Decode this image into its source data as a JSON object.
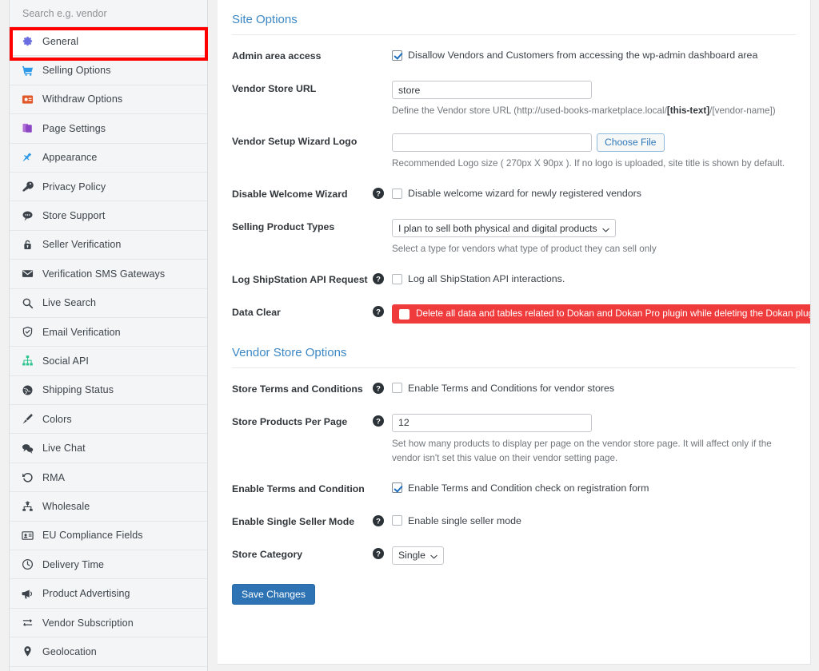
{
  "sidebar": {
    "search": {
      "placeholder": "Search e.g. vendor",
      "value": ""
    },
    "items": [
      {
        "label": "General",
        "icon": "gear-icon",
        "active": true
      },
      {
        "label": "Selling Options",
        "icon": "cart-icon",
        "active": false
      },
      {
        "label": "Withdraw Options",
        "icon": "withdraw-icon",
        "active": false
      },
      {
        "label": "Page Settings",
        "icon": "pages-icon",
        "active": false
      },
      {
        "label": "Appearance",
        "icon": "pushpin-icon",
        "active": false
      },
      {
        "label": "Privacy Policy",
        "icon": "key-icon",
        "active": false
      },
      {
        "label": "Store Support",
        "icon": "chat-bubble-icon",
        "active": false
      },
      {
        "label": "Seller Verification",
        "icon": "lock-icon",
        "active": false
      },
      {
        "label": "Verification SMS Gateways",
        "icon": "envelope-icon",
        "active": false
      },
      {
        "label": "Live Search",
        "icon": "search-icon",
        "active": false
      },
      {
        "label": "Email Verification",
        "icon": "shield-icon",
        "active": false
      },
      {
        "label": "Social API",
        "icon": "sitemap-icon",
        "active": false
      },
      {
        "label": "Shipping Status",
        "icon": "globe-icon",
        "active": false
      },
      {
        "label": "Colors",
        "icon": "brush-icon",
        "active": false
      },
      {
        "label": "Live Chat",
        "icon": "comments-icon",
        "active": false
      },
      {
        "label": "RMA",
        "icon": "undo-icon",
        "active": false
      },
      {
        "label": "Wholesale",
        "icon": "hierarchy-icon",
        "active": false
      },
      {
        "label": "EU Compliance Fields",
        "icon": "id-card-icon",
        "active": false
      },
      {
        "label": "Delivery Time",
        "icon": "clock-icon",
        "active": false
      },
      {
        "label": "Product Advertising",
        "icon": "megaphone-icon",
        "active": false
      },
      {
        "label": "Vendor Subscription",
        "icon": "refresh-box-icon",
        "active": false
      },
      {
        "label": "Geolocation",
        "icon": "map-pin-icon",
        "active": false
      }
    ]
  },
  "colors": {
    "section_heading": "#3c87c4",
    "danger": "#ef3b3b",
    "primary_button": "#2e74b5",
    "highlight_outline": "#ff0000"
  },
  "site_options": {
    "heading": "Site Options",
    "admin_area_access": {
      "label": "Admin area access",
      "checkbox_label": "Disallow Vendors and Customers from accessing the wp-admin dashboard area",
      "checked": true
    },
    "vendor_store_url": {
      "label": "Vendor Store URL",
      "value": "store",
      "hint_before": "Define the Vendor store URL (http://used-books-marketplace.local/",
      "hint_bold": "[this-text]",
      "hint_after": "/[vendor-name])"
    },
    "vendor_setup_wizard_logo": {
      "label": "Vendor Setup Wizard Logo",
      "value": "",
      "button": "Choose File",
      "hint": "Recommended Logo size ( 270px X 90px ). If no logo is uploaded, site title is shown by default."
    },
    "disable_welcome_wizard": {
      "label": "Disable Welcome Wizard",
      "checkbox_label": "Disable welcome wizard for newly registered vendors",
      "checked": false
    },
    "selling_product_types": {
      "label": "Selling Product Types",
      "selected": "I plan to sell both physical and digital products",
      "hint": "Select a type for vendors what type of product they can sell only"
    },
    "log_shipstation": {
      "label": "Log ShipStation API Request",
      "checkbox_label": "Log all ShipStation API interactions.",
      "checked": false
    },
    "data_clear": {
      "label": "Data Clear",
      "checkbox_label": "Delete all data and tables related to Dokan and Dokan Pro plugin while deleting the Dokan plugin.",
      "checked": false
    }
  },
  "vendor_store_options": {
    "heading": "Vendor Store Options",
    "store_terms": {
      "label": "Store Terms and Conditions",
      "checkbox_label": "Enable Terms and Conditions for vendor stores",
      "checked": false
    },
    "products_per_page": {
      "label": "Store Products Per Page",
      "value": "12",
      "hint": "Set how many products to display per page on the vendor store page. It will affect only if the vendor isn't set this value on their vendor setting page."
    },
    "enable_terms_condition": {
      "label": "Enable Terms and Condition",
      "checkbox_label": "Enable Terms and Condition check on registration form",
      "checked": true
    },
    "single_seller_mode": {
      "label": "Enable Single Seller Mode",
      "checkbox_label": "Enable single seller mode",
      "checked": false
    },
    "store_category": {
      "label": "Store Category",
      "selected": "Single"
    }
  },
  "footer": {
    "save_label": "Save Changes"
  }
}
